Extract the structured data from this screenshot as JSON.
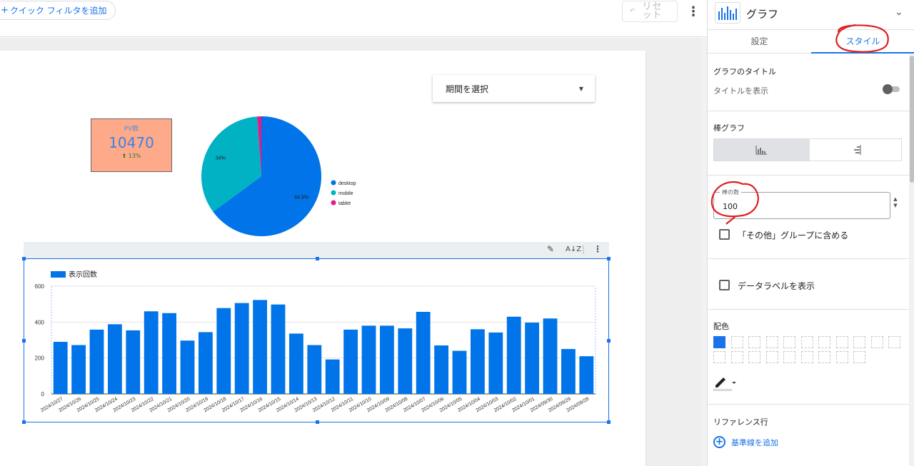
{
  "toolbar": {
    "quick_filter_label": "クイック フィルタを追加",
    "reset_label": "リセット"
  },
  "date_picker": {
    "label": "期間を選択"
  },
  "scorecard": {
    "label": "PV数",
    "value": "10470",
    "delta": "13%"
  },
  "pie": {
    "slices": [
      {
        "name": "desktop",
        "value": 64.9,
        "label": "64.9%",
        "color": "#0074e8"
      },
      {
        "name": "mobile",
        "value": 34.0,
        "label": "34%",
        "color": "#00b2c4"
      },
      {
        "name": "tablet",
        "value": 1.1,
        "label": "",
        "color": "#e8188a"
      }
    ]
  },
  "chart_data": {
    "type": "bar",
    "legend": "表示回数",
    "color": "#0074e8",
    "ylim": [
      0,
      600
    ],
    "yticks": [
      0,
      200,
      400,
      600
    ],
    "categories": [
      "2024/10/27",
      "2024/10/26",
      "2024/10/25",
      "2024/10/24",
      "2024/10/23",
      "2024/10/22",
      "2024/10/21",
      "2024/10/20",
      "2024/10/19",
      "2024/10/18",
      "2024/10/17",
      "2024/10/16",
      "2024/10/15",
      "2024/10/14",
      "2024/10/13",
      "2024/10/12",
      "2024/10/11",
      "2024/10/10",
      "2024/10/09",
      "2024/10/08",
      "2024/10/07",
      "2024/10/06",
      "2024/10/05",
      "2024/10/04",
      "2024/10/03",
      "2024/10/02",
      "2024/10/01",
      "2024/09/30",
      "2024/09/29",
      "2024/09/28"
    ],
    "values": [
      290,
      272,
      358,
      388,
      354,
      460,
      450,
      297,
      344,
      478,
      506,
      523,
      498,
      336,
      272,
      192,
      358,
      380,
      380,
      365,
      457,
      270,
      240,
      360,
      342,
      430,
      397,
      420,
      250,
      210
    ]
  },
  "panel": {
    "title": "グラフ",
    "tabs": [
      {
        "label": "設定"
      },
      {
        "label": "スタイル"
      }
    ],
    "chart_title_section": "グラフのタイトル",
    "show_title_label": "タイトルを表示",
    "bar_section": "棒グラフ",
    "bars_field_label": "棒の数",
    "bars_field_value": "100",
    "others_group_label": "「その他」グループに含める",
    "data_labels_label": "データラベルを表示",
    "color_section": "配色",
    "reference_section": "リファレンス行",
    "add_reference_label": "基準線を追加"
  }
}
